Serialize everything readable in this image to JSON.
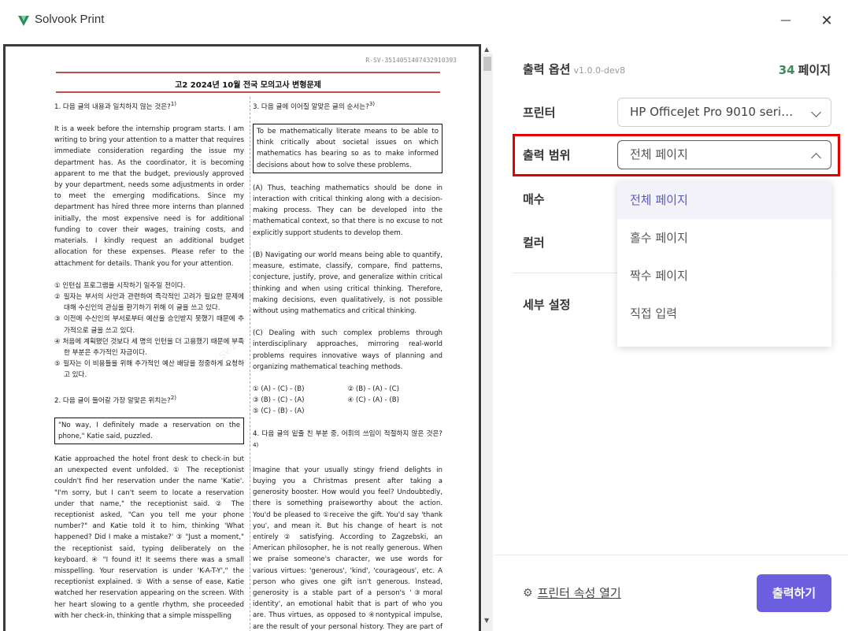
{
  "window": {
    "title": "Solvook Print",
    "minimize_glyph": "—",
    "close_glyph": "✕"
  },
  "document": {
    "code": "R-SV-3514051407432910393",
    "heading": "고2 2024년 10월 전국 모의고사 변형문제",
    "watermark": "SV-2",
    "left": {
      "q1_title": "1. 다음 글의 내용과 일치하지 않는 것은?",
      "q1_title_u": "않는",
      "q1_title_sup": "1)",
      "q1_passage": "It is a week before the internship program starts. I am writing to bring your attention to a matter that requires immediate consideration regarding the issue my department has. As the coordinator, it is becoming apparent to me that the budget, previously approved by your department, needs some adjustments in order to meet the emerging modifications. Since my department has hired three more interns than planned initially, the most expensive need is for additional funding to cover their wages, training costs, and materials. I kindly request an additional budget allocation for these expenses. Please refer to the attachment for details. Thank you for your attention.",
      "q1_choices": [
        "① 인턴십 프로그램을 시작하기 일주일 전이다.",
        "② 필자는 부서의 사안과 관련하여 즉각적인 고려가 필요한 문제에 대해 수신인의 관심을 환기하기 위해 이 글을 쓰고 있다.",
        "③ 이전에 수신인의 부서로부터 예산을 승인받지 못했기 때문에 추가적으로 글을 쓰고 있다.",
        "④ 처음에 계획됐던 것보다 세 명의 인턴을 더 고용했기 때문에 부족한 부분은 추가적인 자금이다.",
        "⑤ 필자는 이 비용들을 위해 추가적인 예산 배당을 정중하게 요청하고 있다."
      ],
      "q2_title": "2. 다음 글이 들어갈 가장 알맞은 위치는?",
      "q2_title_sup": "2)",
      "q2_box": "\"No way, I definitely made a reservation on the phone,\" Katie said, puzzled.",
      "q2_passage": "Katie approached the hotel front desk to check-in but an unexpected event unfolded. ① The receptionist couldn't find her reservation under the name 'Katie'. \"I'm sorry, but I can't seem to locate a reservation under that name,\" the receptionist said. ② The receptionist asked, \"Can you tell me your phone number?\" and Katie told it to him, thinking 'What happened? Did I make a mistake?' ③ \"Just a moment,\" the receptionist said, typing deliberately on the keyboard. ④ \"I found it! It seems there was a small misspelling. Your reservation is under 'K-A-T-Y',\" the receptionist explained. ⑤ With a sense of ease, Katie watched her reservation appearing on the screen. With her heart slowing to a gentle rhythm, she proceeded with her check-in, thinking that a simple misspelling"
    },
    "right": {
      "q3_title": "3. 다음 글에 이어질 알맞은 글의 순서는?",
      "q3_title_sup": "3)",
      "q3_box": "To be mathematically literate means to be able to think critically about societal issues on which mathematics has bearing so as to make informed decisions about how to solve these problems.",
      "q3_a": "(A) Thus, teaching mathematics should be done in interaction with critical thinking along with a decision-making process. They can be developed into the mathematical context, so that there is no excuse to not explicitly support students to develop them.",
      "q3_b": "(B) Navigating our world means being able to quantify, measure, estimate, classify, compare, find patterns, conjecture, justify, prove, and generalize within critical thinking and when using critical thinking. Therefore, making decisions, even qualitatively, is not possible without using mathematics and critical thinking.",
      "q3_c": "(C) Dealing with such complex problems through interdisciplinary approaches, mirroring real-world problems requires innovative ways of planning and organizing mathematical teaching methods.",
      "q3_opt1": "① (A) - (C) - (B)",
      "q3_opt2": "② (B) - (A) - (C)",
      "q3_opt3": "③ (B) - (C) - (A)",
      "q3_opt4": "④ (C) - (A) - (B)",
      "q3_opt5": "⑤ (C) - (B) - (A)",
      "q4_title": "4. 다음 글의 밑줄 친 부분 중, 어휘의 쓰임이 적절하지 않은 것은?",
      "q4_title_sup": "4)",
      "q4_passage": "Imagine that your usually stingy friend delights in buying you a Christmas present after taking a generosity booster. How would you feel? Undoubtedly, there is something praiseworthy about the action. You'd be pleased to ①receive the gift. You'd say 'thank you', and mean it. But his change of heart is not entirely ② satisfying. According to Zagzebski, an American philosopher, he is not really generous. When we praise someone's character, we use words for various virtues: 'generous', 'kind', 'courageous', etc. A person who gives one gift isn't generous. Instead, generosity is a stable part of a person's '③moral identity', an emotional habit that is part of who you are. Thus virtues, as opposed to ④nontypical impulse, are the result of your personal history. They are part of who you are, as they are part"
    }
  },
  "panel": {
    "options_label": "출력 옵션",
    "version": "v1.0.0-dev8",
    "page_count": "34",
    "page_unit": "페이지",
    "printer_label": "프린터",
    "printer_value": "HP OfficeJet Pro 9010 series ...",
    "range_label": "출력 범위",
    "range_value": "전체 페이지",
    "copies_label": "매수",
    "color_label": "컬러",
    "detail_label": "세부 설정",
    "dropdown_items": [
      "전체 페이지",
      "홀수 페이지",
      "짝수 페이지",
      "직접 입력"
    ],
    "printer_props": "프린터 속성 열기",
    "print_button": "출력하기",
    "accent_color": "#6b5fe0",
    "highlight_color": "#e00000",
    "page_count_color": "#3d8a5c"
  }
}
